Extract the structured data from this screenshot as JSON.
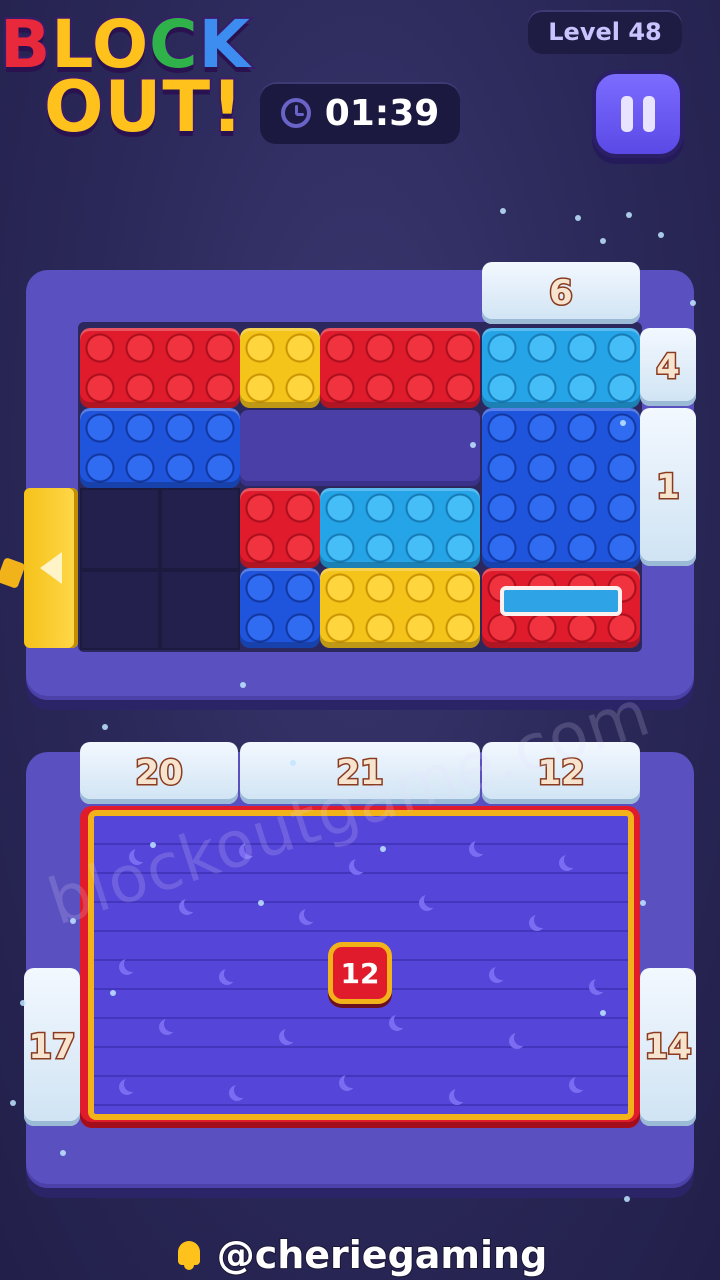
{
  "header": {
    "logo_line1": [
      "B",
      "L",
      "O",
      "C",
      "K"
    ],
    "logo_line2": "OUT!",
    "level_label": "Level 48",
    "timer": "01:39"
  },
  "top_board": {
    "gates": {
      "top": "6",
      "right_top": "4",
      "right_mid": "1"
    }
  },
  "bottom_board": {
    "gates": {
      "top_left": "20",
      "top_mid": "21",
      "top_right": "12",
      "left": "17",
      "right": "14"
    },
    "tray_count": "12"
  },
  "watermark": "blockoutgame.com",
  "footer": {
    "handle": "@cheriegaming"
  },
  "colors": {
    "red": "#e01b2c",
    "yellow": "#f5c41b",
    "blue": "#1f55dc",
    "cyan": "#25a5e8",
    "board": "#5b50bf",
    "background": "#2a2858"
  },
  "icons": {
    "timer": "clock-icon",
    "pause": "pause-icon",
    "exit": "left-arrow-icon",
    "footer": "bell-icon"
  }
}
